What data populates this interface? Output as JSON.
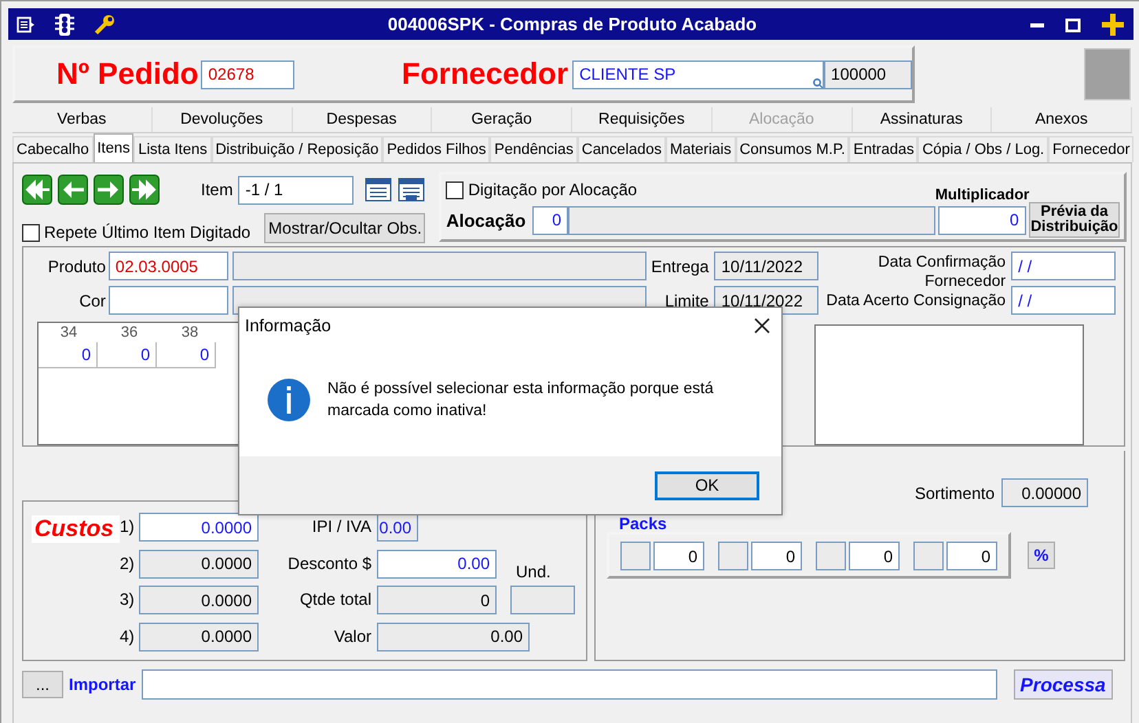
{
  "window": {
    "title": "004006SPK - Compras de Produto Acabado"
  },
  "header": {
    "order_label": "Nº Pedido",
    "order_number": "02678",
    "supplier_label": "Fornecedor",
    "supplier_name": "CLIENTE SP",
    "supplier_code": "100000"
  },
  "tabs_top": [
    {
      "label": "Verbas",
      "disabled": false
    },
    {
      "label": "Devoluções",
      "disabled": false
    },
    {
      "label": "Despesas",
      "disabled": false
    },
    {
      "label": "Geração",
      "disabled": false
    },
    {
      "label": "Requisições",
      "disabled": false
    },
    {
      "label": "Alocação",
      "disabled": true
    },
    {
      "label": "Assinaturas",
      "disabled": false
    },
    {
      "label": "Anexos",
      "disabled": false
    }
  ],
  "tabs": [
    {
      "label": "Cabecalho",
      "selected": false
    },
    {
      "label": "Itens",
      "selected": true
    },
    {
      "label": "Lista Itens",
      "selected": false
    },
    {
      "label": "Distribuição / Reposição",
      "selected": false
    },
    {
      "label": "Pedidos Filhos",
      "selected": false
    },
    {
      "label": "Pendências",
      "selected": false
    },
    {
      "label": "Cancelados",
      "selected": false
    },
    {
      "label": "Materiais",
      "selected": false
    },
    {
      "label": "Consumos M.P.",
      "selected": false
    },
    {
      "label": "Entradas",
      "selected": false
    },
    {
      "label": "Cópia / Obs / Log.",
      "selected": false
    },
    {
      "label": "Fornecedor",
      "selected": false
    }
  ],
  "item_nav": {
    "item_label": "Item",
    "item_value": "-1 / 1",
    "repeat_label": "Repete Último Item Digitado",
    "repeat_checked": false,
    "toggle_obs_button": "Mostrar/Ocultar Obs."
  },
  "allocation": {
    "typing_label": "Digitação por Alocação",
    "typing_checked": false,
    "multiplier_label": "Multiplicador",
    "allocation_label": "Alocação",
    "allocation_value": "0",
    "multiplier_value": "0",
    "preview_button": "Prévia da Distribuição"
  },
  "product": {
    "product_label": "Produto",
    "product_code": "02.03.0005",
    "color_label": "Cor",
    "delivery_label": "Entrega",
    "delivery_date": "10/11/2022",
    "limit_label": "Limite",
    "limit_date": "10/11/2022",
    "confirm_label": "Data Confirmação Fornecedor",
    "confirm_value": "/ /",
    "consign_label": "Data Acerto Consignação",
    "consign_value": "/ /"
  },
  "size_grid": {
    "columns": [
      {
        "size": "34",
        "qty": "0"
      },
      {
        "size": "36",
        "qty": "0"
      },
      {
        "size": "38",
        "qty": "0"
      }
    ]
  },
  "costs": {
    "title": "Custos",
    "rows": [
      {
        "label": "1)",
        "value": "0.0000",
        "editable": true
      },
      {
        "label": "2)",
        "value": "0.0000",
        "editable": false
      },
      {
        "label": "3)",
        "value": "0.0000",
        "editable": false
      },
      {
        "label": "4)",
        "value": "0.0000",
        "editable": false
      }
    ],
    "ipi_label": "IPI / IVA",
    "ipi_value": "0.00",
    "discount_label": "Desconto $",
    "discount_value": "0.00",
    "qty_label": "Qtde total",
    "qty_value": "0",
    "value_label": "Valor",
    "value_value": "0.00",
    "unit_label": "Und."
  },
  "packs": {
    "assortment_label": "Sortimento",
    "assortment_value": "0.00000",
    "title": "Packs",
    "items": [
      "0",
      "0",
      "0",
      "0"
    ],
    "percent_button": "%"
  },
  "import": {
    "more_button": "...",
    "label": "Importar",
    "process_button": "Processa"
  },
  "dialog": {
    "title": "Informação",
    "message": "Não é possível selecionar esta informação porque está marcada como inativa!",
    "ok_button": "OK"
  }
}
